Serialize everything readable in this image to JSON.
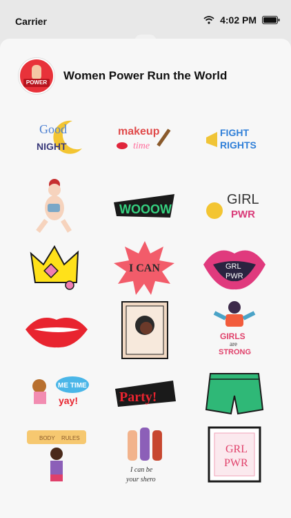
{
  "status": {
    "carrier": "Carrier",
    "time": "4:02 PM"
  },
  "app": {
    "title": "Women Power Run the World",
    "icon_text": "POWER"
  },
  "stickers": [
    {
      "name": "good-night-sticker",
      "lines": [
        "Good",
        "NIGHT"
      ]
    },
    {
      "name": "makeup-time-sticker",
      "lines": [
        "makeup",
        "time"
      ]
    },
    {
      "name": "fight-rights-sticker",
      "lines": [
        "FIGHT",
        "RIGHTS"
      ]
    },
    {
      "name": "girl-with-cup-sticker",
      "lines": []
    },
    {
      "name": "wooow-sticker",
      "lines": [
        "WOOOW"
      ]
    },
    {
      "name": "girl-pwr-sticker",
      "lines": [
        "GIRL",
        "PWR"
      ]
    },
    {
      "name": "crown-sticker",
      "lines": []
    },
    {
      "name": "i-can-sticker",
      "lines": [
        "I CAN"
      ]
    },
    {
      "name": "lips-girl-pwr-sticker",
      "lines": [
        "GRL",
        "PWR"
      ]
    },
    {
      "name": "lips-sticker",
      "lines": []
    },
    {
      "name": "portrait-frame-sticker",
      "lines": []
    },
    {
      "name": "girls-are-strong-sticker",
      "lines": [
        "GIRLS",
        "are",
        "STRONG"
      ]
    },
    {
      "name": "me-time-yay-sticker",
      "lines": [
        "ME TIME",
        "yay!"
      ]
    },
    {
      "name": "party-sticker",
      "lines": [
        "Party!"
      ]
    },
    {
      "name": "shorts-sticker",
      "lines": []
    },
    {
      "name": "body-rules-sticker",
      "lines": [
        "BODY",
        "RULES"
      ]
    },
    {
      "name": "fists-sticker",
      "lines": [
        "I can be",
        "your shero"
      ]
    },
    {
      "name": "grl-pwr-frame-sticker",
      "lines": [
        "GRL",
        "PWR"
      ]
    }
  ]
}
